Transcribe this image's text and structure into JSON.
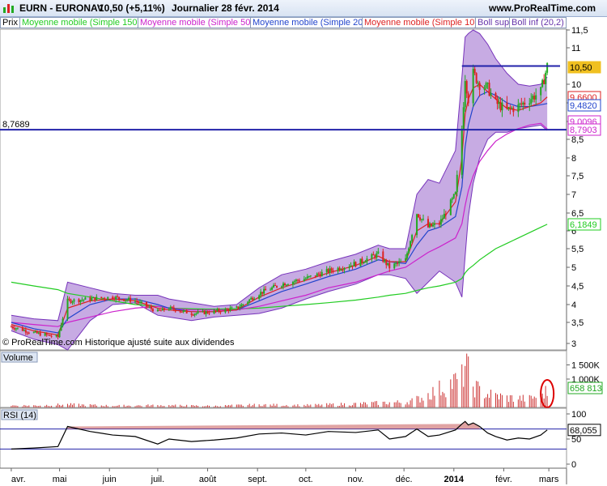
{
  "header": {
    "symbol": "EURN - EURONAV",
    "price": "10,50 (+5,11%)",
    "period": "Journalier  28 févr. 2014",
    "site": "www.ProRealTime.com"
  },
  "legend": [
    {
      "label": "Prix",
      "color": "#000000"
    },
    {
      "label": "Moyenne mobile (Simple 150)",
      "color": "#22cc22"
    },
    {
      "label": "Moyenne mobile (Simple 50)",
      "color": "#cc22cc"
    },
    {
      "label": "Moyenne mobile (Simple 20)",
      "color": "#2244cc"
    },
    {
      "label": "Moyenne mobile (Simple 10)",
      "color": "#dd2222"
    },
    {
      "label": "Boll sup",
      "color": "#6633aa"
    },
    {
      "label": "Boll inf (20,2)",
      "color": "#6633aa"
    }
  ],
  "watermark": "© ProRealTime.com  Historique ajusté suite aux dividendes",
  "colors": {
    "up": "#22aa22",
    "down": "#dd2222",
    "sma150": "#22cc22",
    "sma50": "#cc22cc",
    "sma20": "#2244cc",
    "sma10": "#dd2222",
    "boll": "#7733bb",
    "boll_fill": "#9966cc",
    "hline": "#2222aa",
    "volume": "#cc3333",
    "rsi": "#000000",
    "rsi_fill": "#cc6666"
  },
  "chart_data": [
    {
      "type": "candlestick",
      "name": "price",
      "x_labels": [
        "avr.",
        "mai",
        "juin",
        "juil.",
        "août",
        "sept.",
        "oct.",
        "nov.",
        "déc.",
        "2014",
        "févr.",
        "mars"
      ],
      "ylim": [
        2.7,
        11.9
      ],
      "y_ticks": [
        3,
        3.5,
        4,
        4.5,
        5,
        5.5,
        6,
        6.5,
        7,
        7.5,
        8,
        8.5,
        9,
        9.5,
        10,
        11,
        11.5
      ],
      "y_tick_labels": [
        "3",
        "3,5",
        "4",
        "4,5",
        "5",
        "5,5",
        "6",
        "6,5",
        "7",
        "7,5",
        "8",
        "8,5",
        "9",
        "9,5",
        "10",
        "11",
        "11,5"
      ],
      "horizontal_lines": [
        {
          "value": 8.7689,
          "label": "8,7689"
        },
        {
          "value": 10.5,
          "label": ""
        }
      ],
      "price_tags": [
        {
          "value": 10.5,
          "label": "10,50",
          "color": "#f0c020"
        },
        {
          "value": 9.66,
          "label": "9,6600",
          "color": "#dd2222"
        },
        {
          "value": 9.482,
          "label": "9,4820",
          "color": "#2244cc"
        },
        {
          "value": 9.0096,
          "label": "9,0096",
          "color": "#cc22cc"
        },
        {
          "value": 8.7903,
          "label": "8,7903",
          "color": "#cc22cc"
        },
        {
          "value": 6.1849,
          "label": "6,1849",
          "color": "#22cc22"
        }
      ],
      "close_series": {
        "x": [
          "2013-04-01",
          "2013-04-15",
          "2013-04-30",
          "2013-05-06",
          "2013-05-20",
          "2013-06-03",
          "2013-06-17",
          "2013-07-01",
          "2013-07-08",
          "2013-07-22",
          "2013-08-05",
          "2013-08-19",
          "2013-09-02",
          "2013-09-16",
          "2013-10-01",
          "2013-10-15",
          "2013-11-01",
          "2013-11-15",
          "2013-11-22",
          "2013-12-02",
          "2013-12-09",
          "2013-12-16",
          "2013-12-23",
          "2014-01-02",
          "2014-01-06",
          "2014-01-08",
          "2014-01-10",
          "2014-01-13",
          "2014-01-17",
          "2014-01-22",
          "2014-01-27",
          "2014-02-03",
          "2014-02-10",
          "2014-02-17",
          "2014-02-24",
          "2014-02-28"
        ],
        "close": [
          3.4,
          3.25,
          3.15,
          4.1,
          4.15,
          4.2,
          4.1,
          3.8,
          3.9,
          3.75,
          3.8,
          3.9,
          4.3,
          4.55,
          4.7,
          4.9,
          5.1,
          5.35,
          5.0,
          5.2,
          6.5,
          6.1,
          6.2,
          7.0,
          8.8,
          10.2,
          9.6,
          10.3,
          10.0,
          9.9,
          9.5,
          9.3,
          9.4,
          9.6,
          9.8,
          10.5
        ]
      },
      "sma10": [
        3.45,
        3.3,
        3.2,
        3.9,
        4.1,
        4.15,
        4.1,
        3.9,
        3.85,
        3.8,
        3.8,
        3.85,
        4.2,
        4.45,
        4.65,
        4.85,
        5.05,
        5.3,
        5.15,
        5.15,
        6.0,
        6.2,
        6.2,
        6.8,
        8.0,
        9.2,
        9.6,
        9.9,
        10.0,
        9.8,
        9.6,
        9.35,
        9.3,
        9.4,
        9.5,
        9.66
      ],
      "sma20": [
        3.5,
        3.35,
        3.25,
        3.6,
        4.0,
        4.15,
        4.15,
        4.0,
        3.9,
        3.8,
        3.8,
        3.85,
        4.1,
        4.35,
        4.55,
        4.75,
        4.95,
        5.2,
        5.15,
        5.1,
        5.6,
        6.0,
        6.1,
        6.4,
        7.2,
        8.3,
        8.9,
        9.4,
        9.7,
        9.8,
        9.7,
        9.5,
        9.4,
        9.4,
        9.45,
        9.482
      ],
      "sma50": [
        3.5,
        3.45,
        3.4,
        3.5,
        3.65,
        3.8,
        3.9,
        3.95,
        3.9,
        3.85,
        3.85,
        3.85,
        3.95,
        4.1,
        4.25,
        4.45,
        4.6,
        4.8,
        4.9,
        5.0,
        5.2,
        5.4,
        5.55,
        5.8,
        6.2,
        6.7,
        7.1,
        7.5,
        7.9,
        8.2,
        8.45,
        8.65,
        8.8,
        8.9,
        8.95,
        8.7903
      ],
      "sma150": [
        4.6,
        4.5,
        4.4,
        4.3,
        4.2,
        4.1,
        4.0,
        3.95,
        3.9,
        3.88,
        3.87,
        3.88,
        3.9,
        3.95,
        4.0,
        4.05,
        4.12,
        4.2,
        4.25,
        4.3,
        4.38,
        4.45,
        4.5,
        4.6,
        4.7,
        4.85,
        4.95,
        5.05,
        5.2,
        5.35,
        5.5,
        5.65,
        5.8,
        5.95,
        6.1,
        6.1849
      ],
      "boll_sup": [
        3.7,
        3.6,
        3.55,
        4.6,
        4.45,
        4.3,
        4.25,
        4.25,
        4.15,
        4.05,
        3.95,
        4.0,
        4.45,
        4.8,
        4.95,
        5.15,
        5.35,
        5.6,
        5.5,
        5.5,
        7.0,
        7.4,
        7.3,
        8.2,
        10.2,
        11.3,
        11.4,
        11.5,
        11.4,
        11.1,
        10.7,
        10.3,
        10.0,
        9.95,
        10.0,
        10.2
      ],
      "boll_inf": [
        3.3,
        3.1,
        2.95,
        2.7,
        3.55,
        4.0,
        4.05,
        3.7,
        3.65,
        3.55,
        3.65,
        3.7,
        3.75,
        3.9,
        4.15,
        4.35,
        4.55,
        4.8,
        4.8,
        4.7,
        4.3,
        4.6,
        4.9,
        4.6,
        4.2,
        5.3,
        6.4,
        7.3,
        8.0,
        8.5,
        8.7,
        8.7,
        8.8,
        8.85,
        8.9,
        8.75
      ]
    },
    {
      "type": "bar",
      "name": "Volume",
      "ylim": [
        0,
        2000000
      ],
      "y_tick_labels": [
        "1 500K",
        "1 000K"
      ],
      "y_ticks": [
        1500000,
        1000000
      ],
      "last_value_label": "658 813",
      "x": [
        "2013-04-15",
        "2013-05-06",
        "2013-06-03",
        "2013-07-01",
        "2013-08-05",
        "2013-09-02",
        "2013-10-01",
        "2013-11-01",
        "2013-12-02",
        "2013-12-10",
        "2014-01-06",
        "2014-01-08",
        "2014-01-10",
        "2014-01-13",
        "2014-01-17",
        "2014-01-22",
        "2014-02-03",
        "2014-02-17",
        "2014-02-28"
      ],
      "values": [
        80000,
        120000,
        70000,
        90000,
        60000,
        110000,
        90000,
        150000,
        220000,
        350000,
        1200000,
        1750000,
        1400000,
        900000,
        700000,
        550000,
        400000,
        350000,
        658813
      ]
    },
    {
      "type": "line",
      "name": "RSI (14)",
      "ylim": [
        0,
        100
      ],
      "y_ticks": [
        0,
        50,
        100
      ],
      "y_tick_labels": [
        "0",
        "50",
        "100"
      ],
      "levels": [
        70,
        30
      ],
      "last_value_label": "68,055",
      "x": [
        "2013-04-01",
        "2013-04-15",
        "2013-04-30",
        "2013-05-06",
        "2013-05-20",
        "2013-06-03",
        "2013-06-17",
        "2013-07-01",
        "2013-07-08",
        "2013-07-22",
        "2013-08-05",
        "2013-08-19",
        "2013-09-02",
        "2013-09-16",
        "2013-10-01",
        "2013-10-15",
        "2013-11-01",
        "2013-11-15",
        "2013-11-22",
        "2013-12-02",
        "2013-12-09",
        "2013-12-16",
        "2013-12-23",
        "2014-01-02",
        "2014-01-06",
        "2014-01-08",
        "2014-01-10",
        "2014-01-13",
        "2014-01-17",
        "2014-01-22",
        "2014-01-27",
        "2014-02-03",
        "2014-02-10",
        "2014-02-17",
        "2014-02-24",
        "2014-02-28"
      ],
      "values": [
        30,
        32,
        35,
        75,
        65,
        58,
        55,
        40,
        50,
        45,
        48,
        52,
        60,
        62,
        58,
        65,
        63,
        68,
        50,
        55,
        70,
        55,
        58,
        68,
        80,
        85,
        78,
        82,
        75,
        62,
        55,
        48,
        52,
        50,
        58,
        68.055
      ]
    }
  ]
}
